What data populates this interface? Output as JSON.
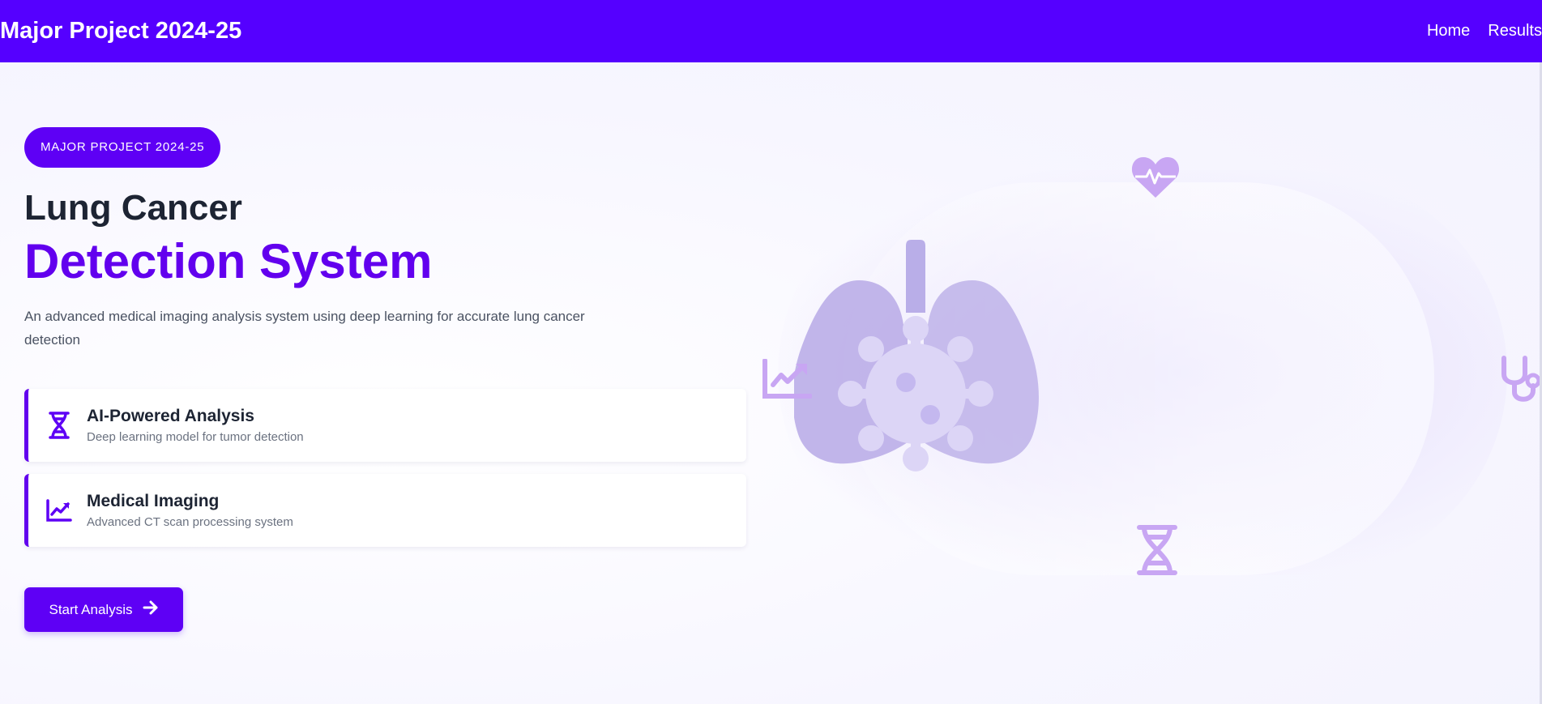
{
  "nav": {
    "brand": "Major Project 2024-25",
    "links": [
      "Home",
      "Results"
    ]
  },
  "hero": {
    "badge": "MAJOR PROJECT 2024-25",
    "title_line1": "Lung Cancer",
    "title_line2": "Detection System",
    "subtitle": "An advanced medical imaging analysis system using deep learning for accurate lung cancer detection",
    "features": [
      {
        "icon": "dna-icon",
        "title": "AI-Powered Analysis",
        "desc": "Deep learning model for tumor detection"
      },
      {
        "icon": "chart-line-icon",
        "title": "Medical Imaging",
        "desc": "Advanced CT scan processing system"
      }
    ],
    "cta_label": "Start Analysis"
  },
  "illustration": {
    "main_icon": "lungs-virus-icon",
    "floating_icons": [
      "heartbeat-icon",
      "chart-line-icon",
      "dna-icon",
      "stethoscope-icon"
    ]
  },
  "colors": {
    "primary": "#5500ff",
    "accent": "#6200ee",
    "text_dark": "#1d2433",
    "text_muted": "#6b7280",
    "icon_light": "#c8a6f3"
  }
}
